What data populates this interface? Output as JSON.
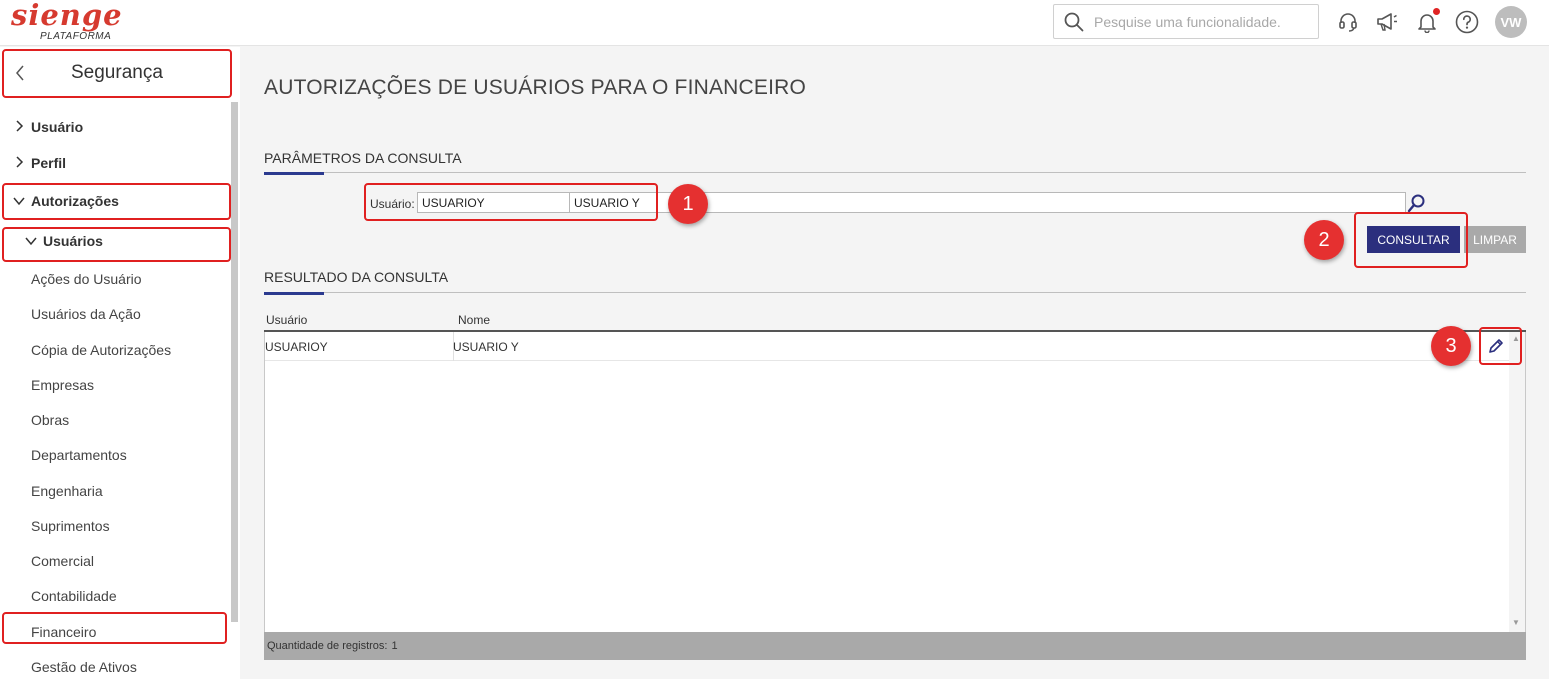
{
  "app": {
    "logo_text": "sienge",
    "logo_sub": "PLATAFORMA",
    "search_placeholder": "Pesquise uma funcionalidade.",
    "user_initials": "VW",
    "header_icons": [
      "search-icon",
      "headset-icon",
      "megaphone-icon",
      "bell-icon",
      "help-icon"
    ]
  },
  "sidebar": {
    "title": "Segurança",
    "groups": [
      {
        "label": "Usuário",
        "expanded": false
      },
      {
        "label": "Perfil",
        "expanded": false
      },
      {
        "label": "Autorizações",
        "expanded": true
      }
    ],
    "subgroup": {
      "label": "Usuários",
      "expanded": true
    },
    "items": [
      "Ações do Usuário",
      "Usuários da Ação",
      "Cópia de Autorizações",
      "Empresas",
      "Obras",
      "Departamentos",
      "Engenharia",
      "Suprimentos",
      "Comercial",
      "Contabilidade",
      "Financeiro",
      "Gestão de Ativos"
    ]
  },
  "main": {
    "page_title": "AUTORIZAÇÕES DE USUÁRIOS PARA O FINANCEIRO",
    "params": {
      "section_title": "PARÂMETROS DA CONSULTA",
      "user_label": "Usuário:",
      "user_code": "USUARIOY",
      "user_name": "USUARIO Y",
      "btn_consultar": "CONSULTAR",
      "btn_limpar": "LIMPAR"
    },
    "results": {
      "section_title": "RESULTADO DA CONSULTA",
      "columns": [
        "Usuário",
        "Nome"
      ],
      "rows": [
        [
          "USUARIOY",
          "USUARIO Y"
        ]
      ],
      "footer_label": "Quantidade de registros:",
      "count": "1"
    }
  },
  "annotations": [
    "1",
    "2",
    "3"
  ],
  "colors": {
    "brand": "#d63a2f",
    "primary_button": "#2b2f7e",
    "accent": "#2b3a8f",
    "annotation": "#e02020"
  }
}
